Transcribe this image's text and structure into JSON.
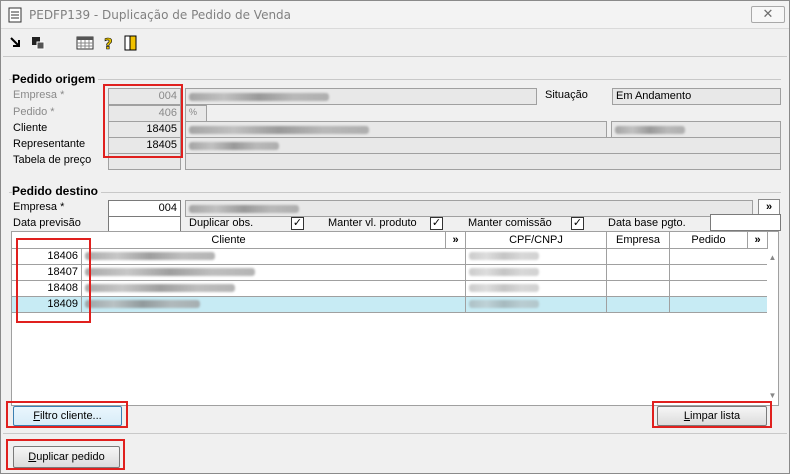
{
  "window": {
    "title": "PEDFP139 - Duplicação de Pedido de Venda",
    "close_glyph": "✕"
  },
  "toolbar": {
    "icons": [
      "export-icon",
      "copy-icon",
      "calendar-grid-icon",
      "help-icon",
      "exit-door-icon"
    ]
  },
  "origem": {
    "title": "Pedido origem",
    "empresa_label": "Empresa *",
    "empresa_value": "004",
    "pedido_label": "Pedido *",
    "pedido_value": "406",
    "cliente_label": "Cliente",
    "cliente_value": "18405",
    "representante_label": "Representante",
    "representante_value": "18405",
    "tabela_label": "Tabela de preço",
    "situacao_label": "Situação",
    "situacao_value": "Em Andamento"
  },
  "destino": {
    "title": "Pedido destino",
    "empresa_label": "Empresa *",
    "empresa_value": "004",
    "data_previsao_label": "Data previsão",
    "duplicar_obs_label": "Duplicar obs.",
    "manter_vl_label": "Manter vl. produto",
    "manter_comissao_label": "Manter comissão",
    "data_base_label": "Data base pgto.",
    "lookup_glyph": "»"
  },
  "grid": {
    "columns": {
      "cliente": "Cliente",
      "cpf": "CPF/CNPJ",
      "empresa": "Empresa",
      "pedido": "Pedido"
    },
    "rows": [
      {
        "code": "18406",
        "selected": false
      },
      {
        "code": "18407",
        "selected": false
      },
      {
        "code": "18408",
        "selected": false
      },
      {
        "code": "18409",
        "selected": true
      }
    ]
  },
  "buttons": {
    "filtro_prefix": "F",
    "filtro_rest": "iltro cliente...",
    "limpar_prefix": "L",
    "limpar_rest": "impar lista",
    "duplicar_prefix": "D",
    "duplicar_rest": "uplicar pedido"
  },
  "colors": {
    "highlight": "#e0201e",
    "selected_row": "#c7ebf4"
  }
}
